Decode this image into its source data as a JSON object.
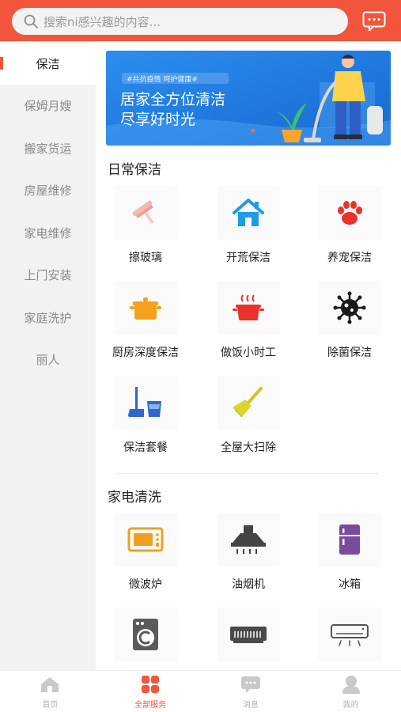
{
  "search": {
    "placeholder": "搜索ni感兴趣的内容..."
  },
  "sidebar": {
    "items": [
      {
        "label": "保洁",
        "active": true
      },
      {
        "label": "保姆月嫂"
      },
      {
        "label": "搬家货运"
      },
      {
        "label": "房屋维修"
      },
      {
        "label": "家电维修"
      },
      {
        "label": "上门安装"
      },
      {
        "label": "家庭洗护"
      },
      {
        "label": "丽人"
      }
    ]
  },
  "banner": {
    "tag": "#共抗疫情 呵护健康#",
    "line1": "居家全方位清洁",
    "line2": "尽享好时光"
  },
  "sections": {
    "daily": {
      "title": "日常保洁",
      "items": [
        {
          "label": "擦玻璃",
          "icon": "squeegee-icon"
        },
        {
          "label": "开荒保洁",
          "icon": "house-icon"
        },
        {
          "label": "养宠保洁",
          "icon": "paw-icon"
        },
        {
          "label": "厨房深度保洁",
          "icon": "pot-icon"
        },
        {
          "label": "做饭小时工",
          "icon": "cooking-pot-icon"
        },
        {
          "label": "除菌保洁",
          "icon": "germ-icon"
        },
        {
          "label": "保洁套餐",
          "icon": "mop-bucket-icon"
        },
        {
          "label": "全屋大扫除",
          "icon": "broom-icon"
        }
      ]
    },
    "appliance": {
      "title": "家电清洗",
      "items": [
        {
          "label": "微波炉",
          "icon": "microwave-icon"
        },
        {
          "label": "油烟机",
          "icon": "range-hood-icon"
        },
        {
          "label": "冰箱",
          "icon": "fridge-icon"
        },
        {
          "label": "",
          "icon": "washing-machine-icon"
        },
        {
          "label": "",
          "icon": "air-conditioner-icon"
        },
        {
          "label": "",
          "icon": "wall-ac-icon"
        }
      ]
    }
  },
  "tabbar": {
    "items": [
      {
        "label": "首页",
        "icon": "home-icon"
      },
      {
        "label": "全部服务",
        "icon": "grid-icon",
        "active": true
      },
      {
        "label": "消息",
        "icon": "chat-icon"
      },
      {
        "label": "我的",
        "icon": "user-icon"
      }
    ]
  },
  "colors": {
    "brand": "#f2553b",
    "sidebar_bg": "#f2f2f2",
    "banner_bg": "#1f7de0"
  }
}
